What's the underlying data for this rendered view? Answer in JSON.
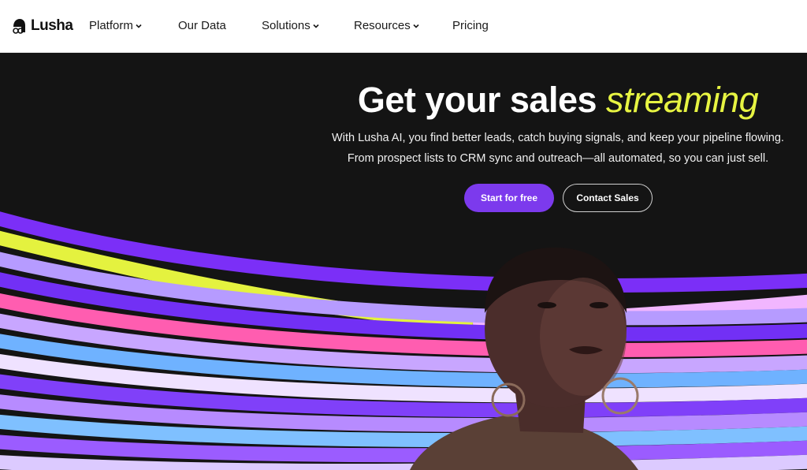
{
  "brand": {
    "name": "Lusha"
  },
  "nav": {
    "items": [
      {
        "label": "Platform",
        "has_dropdown": true
      },
      {
        "label": "Our Data",
        "has_dropdown": false
      },
      {
        "label": "Solutions",
        "has_dropdown": true
      },
      {
        "label": "Resources",
        "has_dropdown": true
      },
      {
        "label": "Pricing",
        "has_dropdown": false
      }
    ]
  },
  "hero": {
    "headline_plain": "Get your sales ",
    "headline_accent": "streaming",
    "subtitle_line1": "With Lusha AI, you find better leads, catch buying signals, and keep your pipeline flowing.",
    "subtitle_line2": "From prospect lists to CRM sync and outreach—all automated, so you can just sell.",
    "primary_cta": "Start for free",
    "secondary_cta": "Contact Sales"
  },
  "colors": {
    "accent_purple": "#7c3aed",
    "accent_yellow": "#e7f442",
    "hero_background": "#141414"
  }
}
